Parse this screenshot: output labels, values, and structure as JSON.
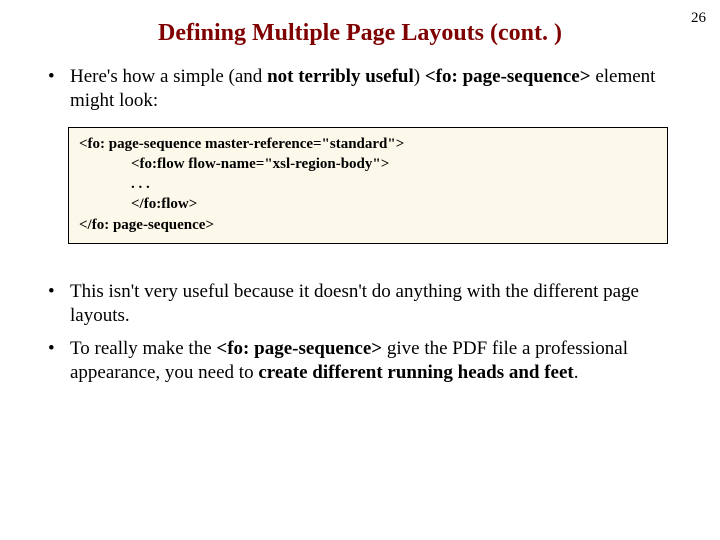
{
  "page_number": "26",
  "title": "Defining Multiple Page Layouts (cont. )",
  "bullets_top": {
    "b1_pre": "Here's how a simple (and ",
    "b1_bold": "not terribly useful",
    "b1_mid": ") ",
    "b1_tag": "<fo: page-sequence>",
    "b1_post": " element might look:"
  },
  "code": {
    "l1": "<fo: page-sequence master-reference=\"standard\">",
    "l2": "<fo:flow flow-name=\"xsl-region-body\">",
    "l3": ". . .",
    "l4": "</fo:flow>",
    "l5": "</fo: page-sequence>"
  },
  "bullets_bottom": {
    "b2": "This isn't very useful because it doesn't do anything with the different page layouts.",
    "b3_pre": "To really make the ",
    "b3_tag": "<fo: page-sequence>",
    "b3_mid": " give the PDF file a professional appearance, you need to ",
    "b3_bold": "create different running heads and feet",
    "b3_post": "."
  }
}
